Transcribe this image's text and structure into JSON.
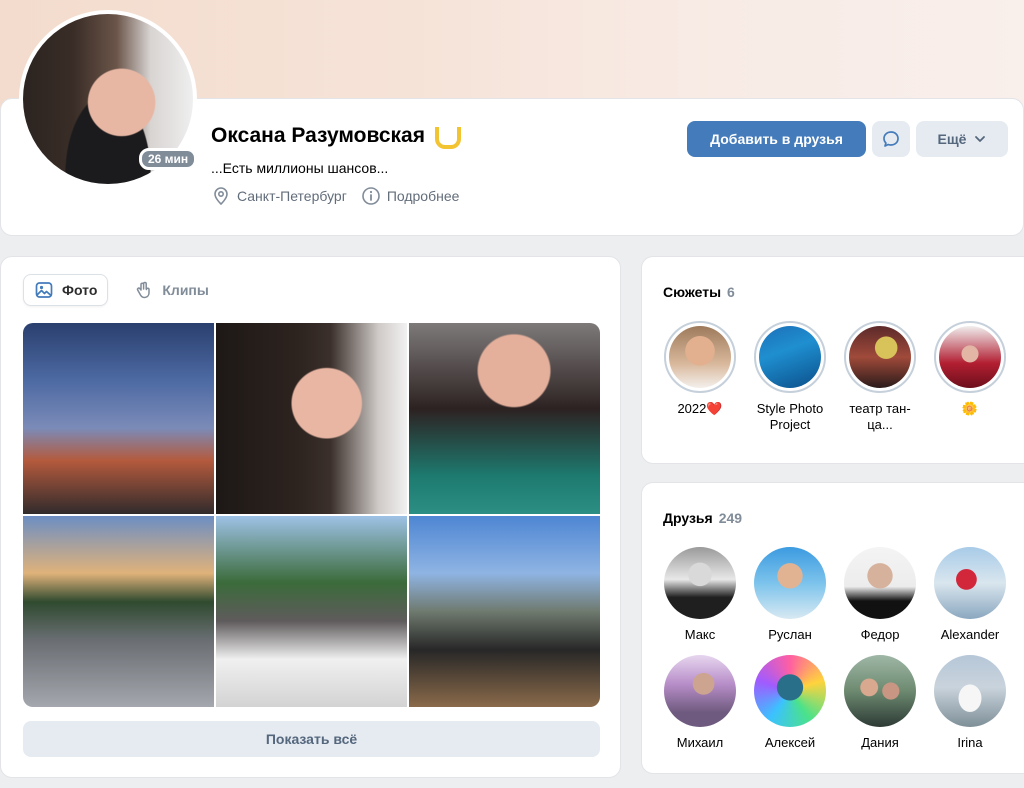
{
  "profile": {
    "name": "Оксана Разумовская",
    "online": "26 мин",
    "status": "...Есть миллионы шансов...",
    "city": "Санкт-Петербург",
    "details": "Подробнее",
    "actions": {
      "add_friend": "Добавить в друзья",
      "more": "Ещё"
    }
  },
  "photos": {
    "tabs": [
      {
        "label": "Фото",
        "active": true
      },
      {
        "label": "Клипы",
        "active": false
      }
    ],
    "show_all": "Показать всё"
  },
  "stories": {
    "title": "Сюжеты",
    "count": "6",
    "items": [
      {
        "label": "2022❤️"
      },
      {
        "label": "Style Photo Project"
      },
      {
        "label": "театр тан-ца..."
      },
      {
        "label": "🌼"
      }
    ]
  },
  "friends": {
    "title": "Друзья",
    "count": "249",
    "items": [
      {
        "name": "Макс"
      },
      {
        "name": "Руслан"
      },
      {
        "name": "Федор"
      },
      {
        "name": "Alexander"
      },
      {
        "name": "Михаил"
      },
      {
        "name": "Алексей"
      },
      {
        "name": "Дания"
      },
      {
        "name": "Irina"
      }
    ]
  },
  "colors": {
    "accent": "#447bba",
    "secondary_button": "#e5ebf1",
    "muted_text": "#818c99",
    "badge": "#818c99"
  }
}
